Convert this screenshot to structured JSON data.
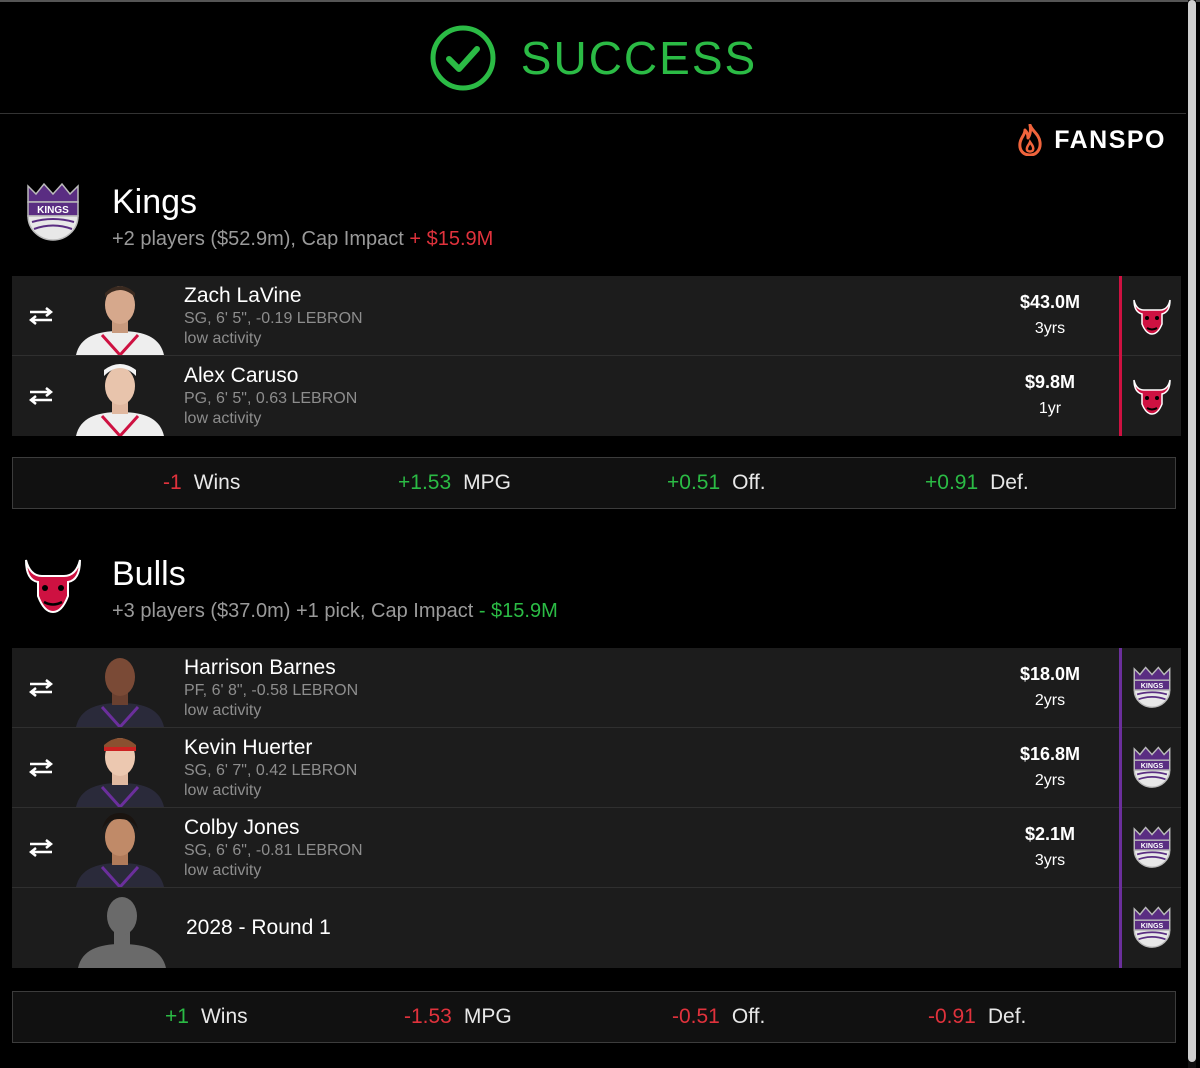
{
  "status": {
    "text": "SUCCESS",
    "color": "#2bbb45"
  },
  "brand": {
    "name": "FANSPO"
  },
  "teams": [
    {
      "name": "Kings",
      "summary_prefix": "+2 players ($52.9m), Cap Impact ",
      "cap_impact": "+ $15.9M",
      "cap_impact_color": "#e0323c",
      "players": [
        {
          "name": "Zach LaVine",
          "meta": "SG, 6' 5\", -0.19 LEBRON",
          "activity": "low activity",
          "amount": "$43.0M",
          "years": "3yrs",
          "from_team": "bulls"
        },
        {
          "name": "Alex Caruso",
          "meta": "PG, 6' 5\", 0.63 LEBRON",
          "activity": "low activity",
          "amount": "$9.8M",
          "years": "1yr",
          "from_team": "bulls"
        }
      ],
      "stats": [
        {
          "value": "-1",
          "label": "Wins",
          "color": "#e0323c"
        },
        {
          "value": "+1.53",
          "label": "MPG",
          "color": "#2bbb45"
        },
        {
          "value": "+0.51",
          "label": "Off.",
          "color": "#2bbb45"
        },
        {
          "value": "+0.91",
          "label": "Def.",
          "color": "#2bbb45"
        }
      ]
    },
    {
      "name": "Bulls",
      "summary_prefix": "+3 players ($37.0m) +1 pick, Cap Impact ",
      "cap_impact": "- $15.9M",
      "cap_impact_color": "#2bbb45",
      "players": [
        {
          "name": "Harrison Barnes",
          "meta": "PF, 6' 8\", -0.58 LEBRON",
          "activity": "low activity",
          "amount": "$18.0M",
          "years": "2yrs",
          "from_team": "kings"
        },
        {
          "name": "Kevin Huerter",
          "meta": "SG, 6' 7\", 0.42 LEBRON",
          "activity": "low activity",
          "amount": "$16.8M",
          "years": "2yrs",
          "from_team": "kings"
        },
        {
          "name": "Colby Jones",
          "meta": "SG, 6' 6\", -0.81 LEBRON",
          "activity": "low activity",
          "amount": "$2.1M",
          "years": "3yrs",
          "from_team": "kings"
        }
      ],
      "pick": {
        "label": "2028 - Round 1",
        "from_team": "kings"
      },
      "stats": [
        {
          "value": "+1",
          "label": "Wins",
          "color": "#2bbb45"
        },
        {
          "value": "-1.53",
          "label": "MPG",
          "color": "#e0323c"
        },
        {
          "value": "-0.51",
          "label": "Off.",
          "color": "#e0323c"
        },
        {
          "value": "-0.91",
          "label": "Def.",
          "color": "#e0323c"
        }
      ]
    }
  ]
}
